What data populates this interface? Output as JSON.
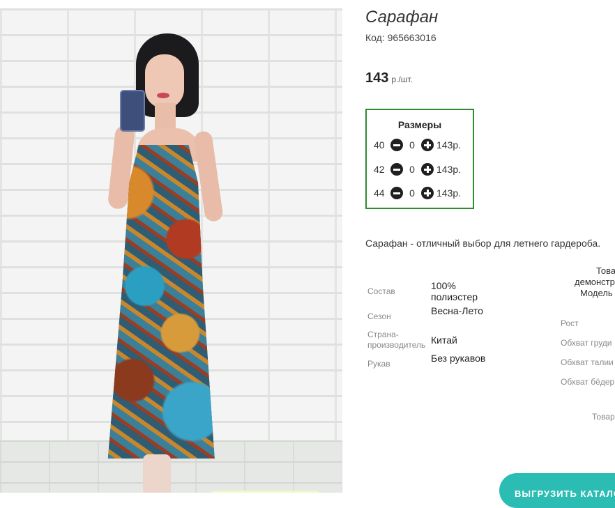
{
  "product": {
    "title": "Сарафан",
    "code": "Код: 965663016",
    "price_value": "143",
    "price_unit": "р./шт."
  },
  "sizes": {
    "title": "Размеры",
    "rows": [
      {
        "size": "40",
        "qty": "0",
        "price": "143р."
      },
      {
        "size": "42",
        "qty": "0",
        "price": "143р."
      },
      {
        "size": "44",
        "qty": "0",
        "price": "143р."
      }
    ]
  },
  "description": "Сарафан - отличный выбор для летнего гардероба.",
  "properties": [
    {
      "label": "Состав",
      "value": "100% полиэстер"
    },
    {
      "label": "Сезон",
      "value": "Весна-Лето"
    },
    {
      "label": "Страна-производитель",
      "value": "Китай"
    },
    {
      "label": "Рукав",
      "value": "Без рукавов"
    }
  ],
  "model_block": {
    "heading_line1": "Това",
    "heading_line2": "демонстр",
    "heading_line3": "Модель",
    "params": [
      "Рост",
      "Обхват груди",
      "Обхват талии",
      "Обхват бёдер"
    ],
    "footer": "Товар"
  },
  "catalog_button": "ВЫГРУЗИТЬ КАТАЛОГ",
  "colors": {
    "sizes_border": "#2e8b2e",
    "catalog_button": "#2bbdb3"
  }
}
